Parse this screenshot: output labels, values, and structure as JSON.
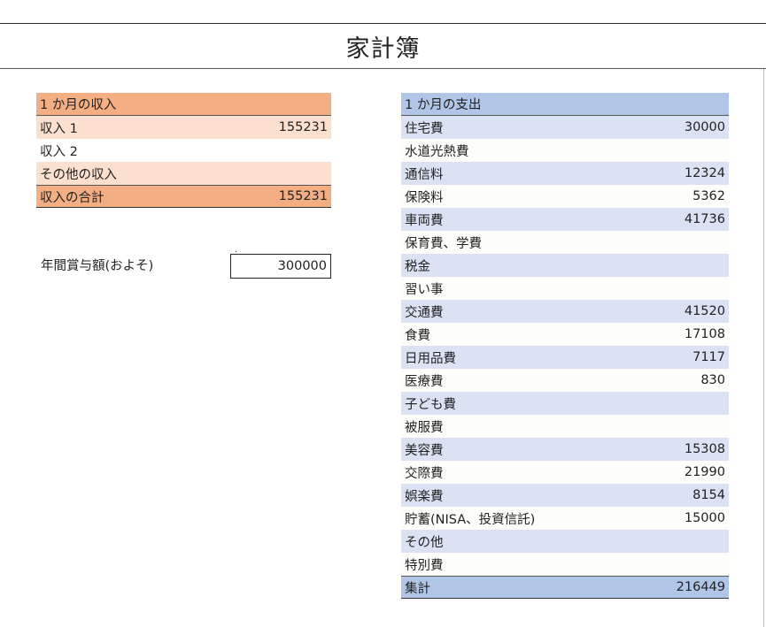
{
  "title": "家計簿",
  "income": {
    "header": "1 か月の収入",
    "rows": [
      {
        "label": "収入 1",
        "value": "155231"
      },
      {
        "label": "収入 2",
        "value": ""
      },
      {
        "label": "その他の収入",
        "value": ""
      }
    ],
    "total": {
      "label": "収入の合計",
      "value": "155231"
    }
  },
  "bonus": {
    "label": "年間賞与額(およそ)",
    "value": "300000"
  },
  "expense": {
    "header": "1 か月の支出",
    "rows": [
      {
        "label": "住宅費",
        "value": "30000"
      },
      {
        "label": "水道光熱費",
        "value": ""
      },
      {
        "label": "通信料",
        "value": "12324"
      },
      {
        "label": "保険料",
        "value": "5362"
      },
      {
        "label": "車両費",
        "value": "41736"
      },
      {
        "label": "保育費、学費",
        "value": ""
      },
      {
        "label": "税金",
        "value": ""
      },
      {
        "label": "習い事",
        "value": ""
      },
      {
        "label": "交通費",
        "value": "41520"
      },
      {
        "label": "食費",
        "value": "17108"
      },
      {
        "label": "日用品費",
        "value": "7117"
      },
      {
        "label": "医療費",
        "value": "830"
      },
      {
        "label": "子ども費",
        "value": ""
      },
      {
        "label": "被服費",
        "value": ""
      },
      {
        "label": "美容費",
        "value": "15308"
      },
      {
        "label": "交際費",
        "value": "21990"
      },
      {
        "label": "娯楽費",
        "value": "8154"
      },
      {
        "label": "貯蓄(NISA、投資信託)",
        "value": "15000"
      },
      {
        "label": "その他",
        "value": ""
      },
      {
        "label": "特別費",
        "value": ""
      }
    ],
    "total": {
      "label": "集計",
      "value": "216449"
    }
  },
  "colors": {
    "income_header": "#f3ae84",
    "income_band": "#fbe0d0",
    "expense_header": "#b1c5e6",
    "expense_band": "#dbe2f3"
  }
}
